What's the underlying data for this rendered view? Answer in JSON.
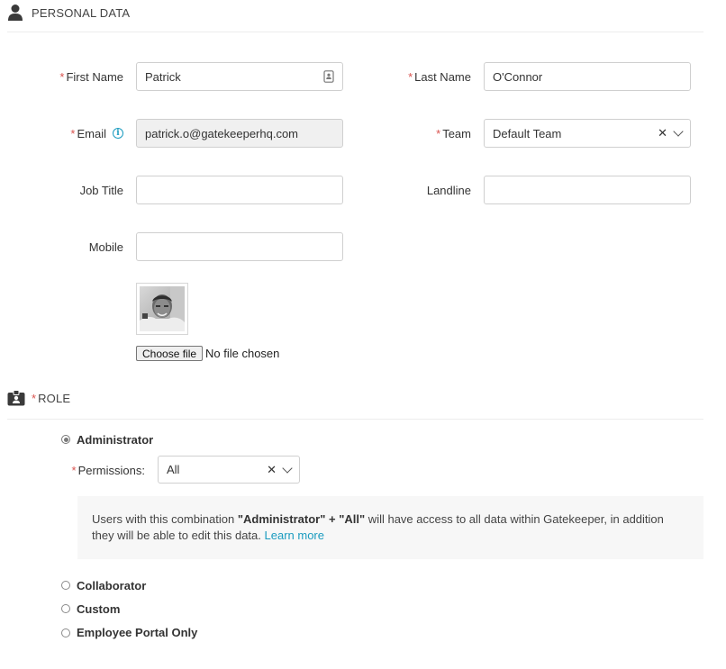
{
  "personal": {
    "title": "PERSONAL DATA",
    "first_name": {
      "label": "First Name",
      "value": "Patrick"
    },
    "last_name": {
      "label": "Last Name",
      "value": "O'Connor"
    },
    "email": {
      "label": "Email",
      "value": "patrick.o@gatekeeperhq.com"
    },
    "team": {
      "label": "Team",
      "value": "Default Team"
    },
    "job_title": {
      "label": "Job Title",
      "value": ""
    },
    "landline": {
      "label": "Landline",
      "value": ""
    },
    "mobile": {
      "label": "Mobile",
      "value": ""
    },
    "file": {
      "button_label": "Choose file",
      "status": "No file chosen"
    }
  },
  "role": {
    "title": "ROLE",
    "options": [
      {
        "label": "Administrator",
        "checked": true
      },
      {
        "label": "Collaborator",
        "checked": false
      },
      {
        "label": "Custom",
        "checked": false
      },
      {
        "label": "Employee Portal Only",
        "checked": false
      }
    ],
    "permissions": {
      "label": "Permissions:",
      "value": "All"
    },
    "notice": {
      "before": "Users with this combination ",
      "strong1": "\"Administrator\"",
      "plus": " + ",
      "strong2": "\"All\"",
      "after": " will have access to all data within Gatekeeper, in addition they will be able to edit this data. ",
      "link": "Learn more"
    }
  },
  "icons": {
    "person": "person-icon",
    "badge": "id-badge-icon",
    "info": "info-icon",
    "contact": "contact-card-icon"
  },
  "colors": {
    "required": "#d9534f",
    "link": "#1a9bbf"
  }
}
